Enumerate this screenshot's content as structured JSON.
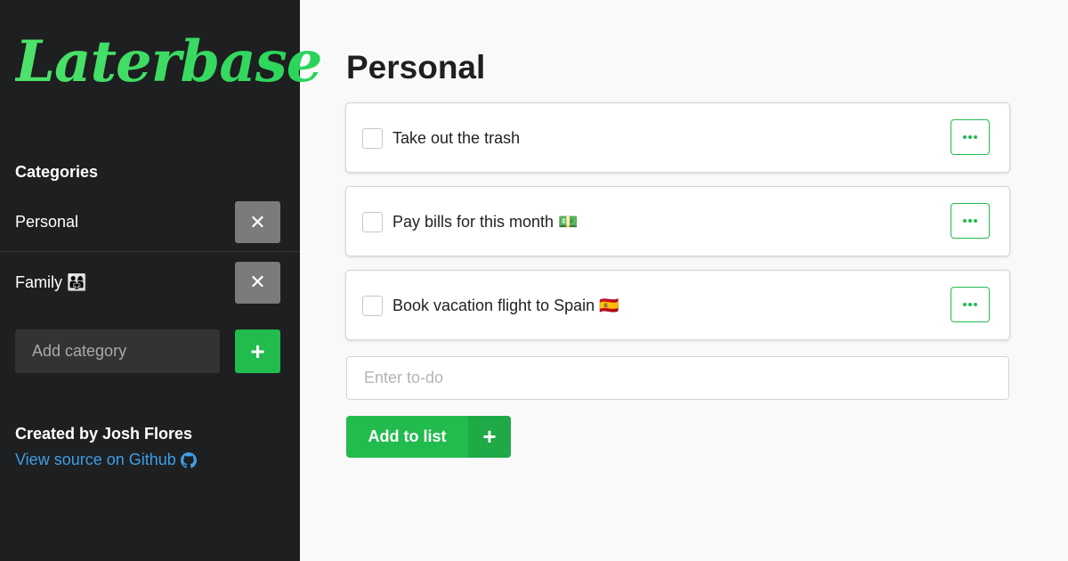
{
  "sidebar": {
    "logo": "Laterbase",
    "categories_heading": "Categories",
    "categories": [
      {
        "label": "Personal",
        "delete_glyph": "✕"
      },
      {
        "label": "Family 👨‍👩‍👧",
        "delete_glyph": "✕"
      }
    ],
    "add_category_placeholder": "Add category",
    "add_category_glyph": "+",
    "credit": "Created by Josh Flores",
    "source_link": "View source on Github",
    "source_icon": "github-icon"
  },
  "main": {
    "title": "Personal",
    "todos": [
      {
        "text": "Take out the trash"
      },
      {
        "text": "Pay bills for this month 💵"
      },
      {
        "text": "Book vacation flight to Spain 🇪🇸"
      }
    ],
    "todo_placeholder": "Enter to-do",
    "add_button_label": "Add to list",
    "add_button_glyph": "+"
  },
  "colors": {
    "sidebar_bg": "#1e1f21",
    "accent_green": "#22bb4e",
    "link_blue": "#3f9ee6",
    "delete_gray": "#7a7b7d"
  }
}
